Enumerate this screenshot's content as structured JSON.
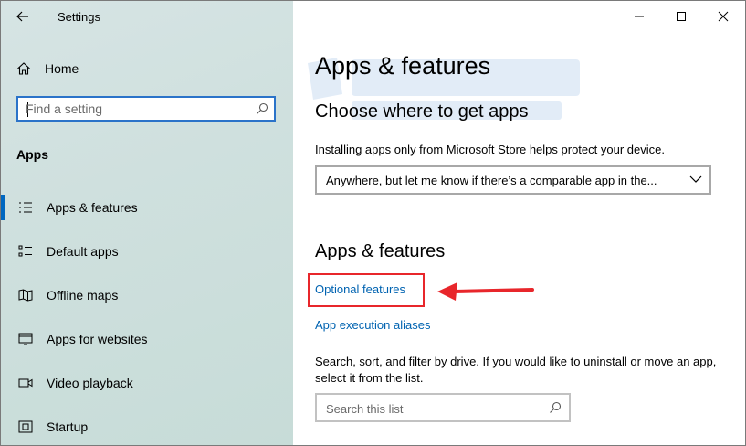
{
  "window": {
    "title": "Settings"
  },
  "sidebar": {
    "home_label": "Home",
    "search_placeholder": "Find a setting",
    "section_label": "Apps",
    "items": [
      {
        "label": "Apps & features",
        "icon": "list-icon",
        "active": true
      },
      {
        "label": "Default apps",
        "icon": "default-apps-icon",
        "active": false
      },
      {
        "label": "Offline maps",
        "icon": "map-icon",
        "active": false
      },
      {
        "label": "Apps for websites",
        "icon": "websites-icon",
        "active": false
      },
      {
        "label": "Video playback",
        "icon": "video-icon",
        "active": false
      },
      {
        "label": "Startup",
        "icon": "startup-icon",
        "active": false
      }
    ]
  },
  "main": {
    "page_title": "Apps & features",
    "choose_heading": "Choose where to get apps",
    "choose_desc": "Installing apps only from Microsoft Store helps protect your device.",
    "source_dropdown_value": "Anywhere, but let me know if there’s a comparable app in the...",
    "features_heading": "Apps & features",
    "optional_features_link": "Optional features",
    "aliases_link": "App execution aliases",
    "list_desc": "Search, sort, and filter by drive. If you would like to uninstall or move an app, select it from the list.",
    "list_search_placeholder": "Search this list"
  },
  "colors": {
    "accent": "#0067c0",
    "link": "#0063b1",
    "highlight": "#e8262b"
  }
}
